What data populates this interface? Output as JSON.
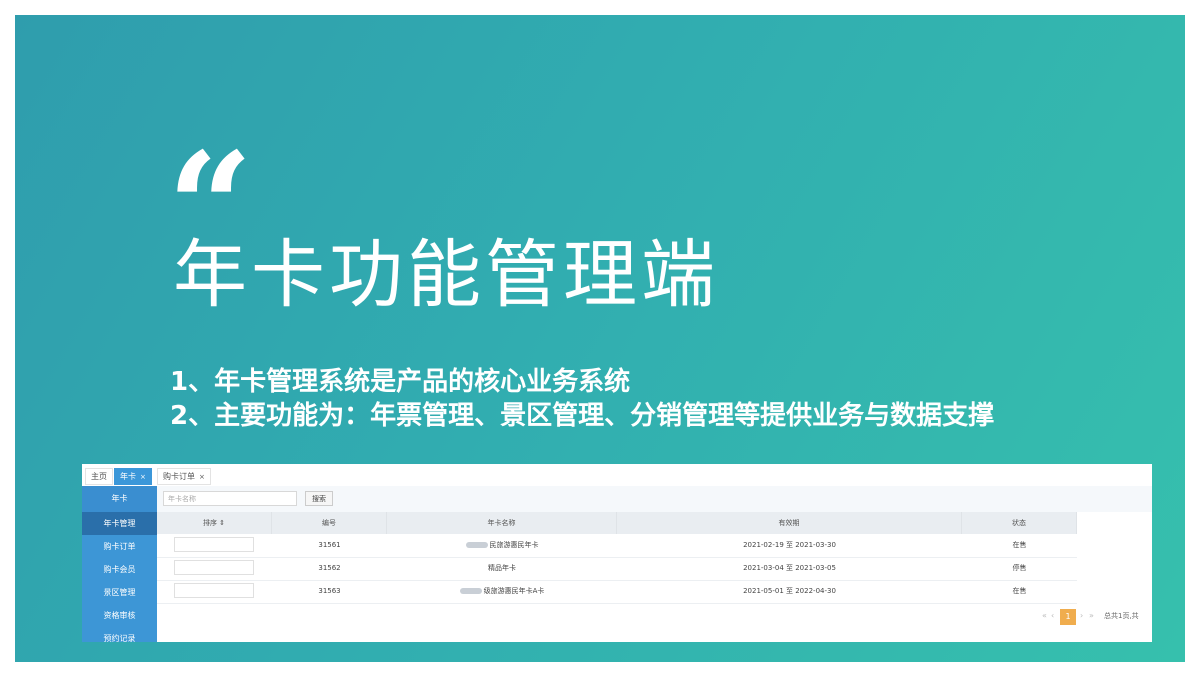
{
  "slide": {
    "quote_mark": "“",
    "title": "年卡功能管理端",
    "bullets": [
      "1、年卡管理系统是产品的核心业务系统",
      "2、主要功能为：年票管理、景区管理、分销管理等提供业务与数据支撑"
    ]
  },
  "screenshot": {
    "tabs": [
      {
        "label": "主页",
        "closable": false,
        "active": false
      },
      {
        "label": "年卡",
        "closable": true,
        "active": true
      },
      {
        "label": "购卡订单",
        "closable": true,
        "active": false
      }
    ],
    "tab_close_glyph": "×",
    "sidebar": {
      "header": "年卡",
      "items": [
        "年卡管理",
        "购卡订单",
        "购卡会员",
        "景区管理",
        "资格审核",
        "预约记录"
      ],
      "active_index": 0
    },
    "search": {
      "placeholder": "年卡名称",
      "button": "搜索"
    },
    "table": {
      "columns": [
        "排序 ⇕",
        "编号",
        "年卡名称",
        "有效期",
        "状态"
      ],
      "rows": [
        {
          "id": "31561",
          "name": "民旅游惠民年卡",
          "validity": "2021-02-19 至 2021-03-30",
          "status": "在售"
        },
        {
          "id": "31562",
          "name": "精品年卡",
          "validity": "2021-03-04 至 2021-03-05",
          "status": "停售"
        },
        {
          "id": "31563",
          "name": "级旅游惠民年卡A卡",
          "validity": "2021-05-01 至 2022-04-30",
          "status": "在售"
        }
      ]
    },
    "pager": {
      "current": "1",
      "info": "总共1页,共"
    },
    "colors": {
      "accent": "#3b97d9",
      "pager_current": "#f0ad4e",
      "slide_start": "#2f9dad",
      "slide_end": "#36c0ad"
    }
  }
}
